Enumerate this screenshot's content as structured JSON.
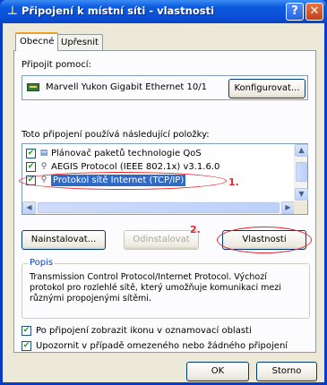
{
  "window": {
    "title": "Připojení k místní síti - vlastnosti",
    "help_glyph": "?",
    "close_glyph": "✕"
  },
  "tabs": [
    {
      "label": "Obecné",
      "active": true
    },
    {
      "label": "Upřesnit",
      "active": false
    }
  ],
  "connect_using": {
    "label": "Připojit pomocí:",
    "adapter_name": "Marvell Yukon Gigabit Ethernet 10/1",
    "configure_label": "Konfigurovat..."
  },
  "components": {
    "label": "Toto připojení používá následující položky:",
    "items": [
      {
        "label": "Plánovač paketů technologie QoS",
        "checked": true,
        "icon": "qos-scheduler-icon"
      },
      {
        "label": "AEGIS Protocol (IEEE 802.1x) v3.1.6.0",
        "checked": true,
        "icon": "network-protocol-icon"
      },
      {
        "label": "Protokol sítě Internet (TCP/IP)",
        "checked": true,
        "selected": true,
        "icon": "network-protocol-icon"
      }
    ],
    "check_glyph": "✔"
  },
  "annotations": {
    "one": "1.",
    "two": "2.",
    "color": "#e8262d"
  },
  "buttons": {
    "install": "Nainstalovat...",
    "uninstall": "Odinstalovat",
    "properties": "Vlastnosti",
    "ok": "OK",
    "cancel": "Storno"
  },
  "description": {
    "legend": "Popis",
    "text": "Transmission Control Protocol/Internet Protocol. Výchozí protokol pro rozlehlé sítě, který umožňuje komunikaci mezi různými propojenými sítěmi."
  },
  "options": [
    {
      "label": "Po připojení zobrazit ikonu v oznamovací oblasti",
      "checked": true
    },
    {
      "label": "Upozornit v případě omezeného nebo žádného připojení",
      "checked": true
    }
  ],
  "scroll_glyphs": {
    "up": "▲",
    "down": "▼",
    "left": "◀",
    "right": "▶"
  },
  "colors": {
    "title_bar": "#0a4fd6",
    "selection": "#316ac5",
    "face": "#ece9d8"
  }
}
